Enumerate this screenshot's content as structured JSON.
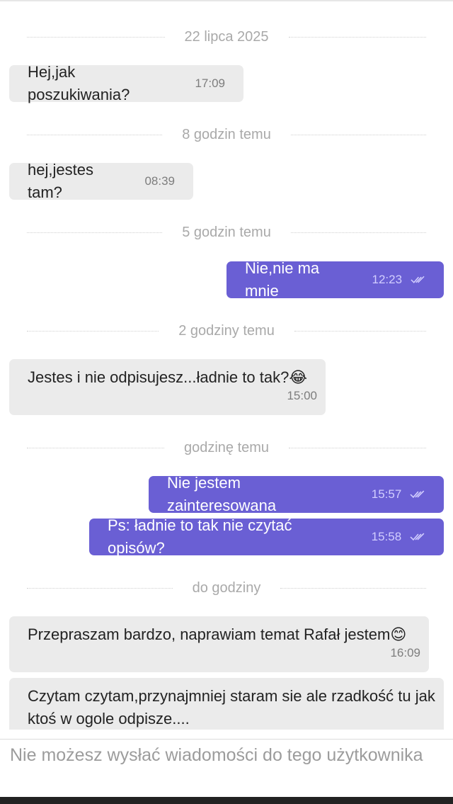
{
  "colors": {
    "outgoing_bubble": "#6a5fd4",
    "incoming_bubble": "#ebebeb",
    "separator_text": "#a9a9a9"
  },
  "separators": [
    "22 lipca 2025",
    "8 godzin temu",
    "5 godzin temu",
    "2 godziny temu",
    "godzinę temu",
    "do godziny"
  ],
  "messages": [
    {
      "direction": "in",
      "text": "Hej,jak poszukiwania?",
      "time": "17:09"
    },
    {
      "direction": "in",
      "text": "hej,jestes tam?",
      "time": "08:39"
    },
    {
      "direction": "out",
      "text": "Nie,nie ma mnie",
      "time": "12:23",
      "status": "read-double-check-icon"
    },
    {
      "direction": "in",
      "text": "Jestes i nie odpisujesz...ładnie to tak?😂",
      "time": "15:00"
    },
    {
      "direction": "out",
      "text": "Nie jestem zainteresowana",
      "time": "15:57",
      "status": "read-double-check-icon"
    },
    {
      "direction": "out",
      "text": "Ps: ładnie to tak nie czytać opisów?",
      "time": "15:58",
      "status": "read-double-check-icon"
    },
    {
      "direction": "in",
      "text": "Przepraszam bardzo, naprawiam temat Rafał jestem😊",
      "time": "16:09"
    },
    {
      "direction": "in",
      "text": "Czytam czytam,przynajmniej staram sie ale rzadkość tu jak ktoś w ogole odpisze...."
    }
  ],
  "composer": {
    "placeholder": "Nie możesz wysłać wiadomości do tego użytkownika"
  }
}
